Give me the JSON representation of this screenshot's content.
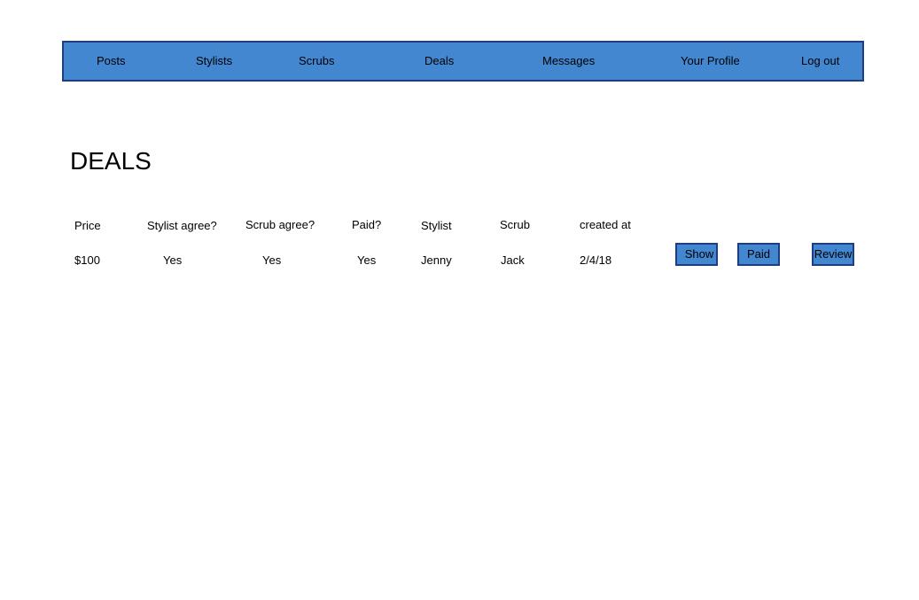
{
  "nav": {
    "posts": "Posts",
    "stylists": "Stylists",
    "scrubs": "Scrubs",
    "deals": "Deals",
    "messages": "Messages",
    "profile": "Your Profile",
    "logout": "Log out"
  },
  "page_title": "DEALS",
  "table": {
    "headers": {
      "price": "Price",
      "stylist_agree": "Stylist agree?",
      "scrub_agree": "Scrub agree?",
      "paid": "Paid?",
      "stylist": "Stylist",
      "scrub": "Scrub",
      "created_at": "created at"
    },
    "rows": [
      {
        "price": "$100",
        "stylist_agree": "Yes",
        "scrub_agree": "Yes",
        "paid": "Yes",
        "stylist": "Jenny",
        "scrub": "Jack",
        "created_at": "2/4/18",
        "show_label": "Show",
        "paid_label": "Paid",
        "review_label": "Review"
      }
    ]
  },
  "colors": {
    "accent": "#4287d0",
    "border": "#1d3f82"
  }
}
